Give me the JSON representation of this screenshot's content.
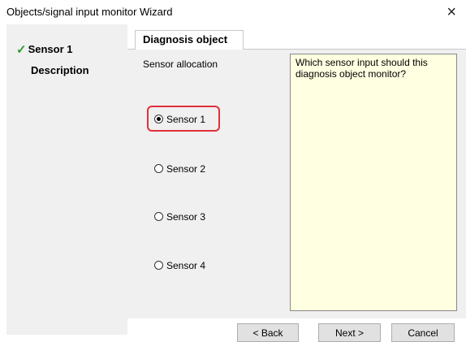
{
  "window": {
    "title": "Objects/signal input monitor Wizard",
    "close_glyph": "×"
  },
  "steps": [
    {
      "label": "Sensor 1",
      "done": true,
      "check_glyph": "✓"
    },
    {
      "label": "Description",
      "done": false
    }
  ],
  "tab": {
    "label": "Diagnosis object"
  },
  "allocation": {
    "label": "Sensor allocation",
    "options": [
      {
        "label": "Sensor 1",
        "selected": true
      },
      {
        "label": "Sensor 2",
        "selected": false
      },
      {
        "label": "Sensor 3",
        "selected": false
      },
      {
        "label": "Sensor 4",
        "selected": false
      }
    ]
  },
  "help_text": "Which sensor input should this diagnosis object monitor?",
  "buttons": {
    "back": "< Back",
    "next": "Next >",
    "cancel": "Cancel"
  },
  "colors": {
    "check": "#2e9b2e",
    "highlight": "#e0303a",
    "help_bg": "#ffffe1",
    "panel_bg": "#f0f0f0"
  }
}
